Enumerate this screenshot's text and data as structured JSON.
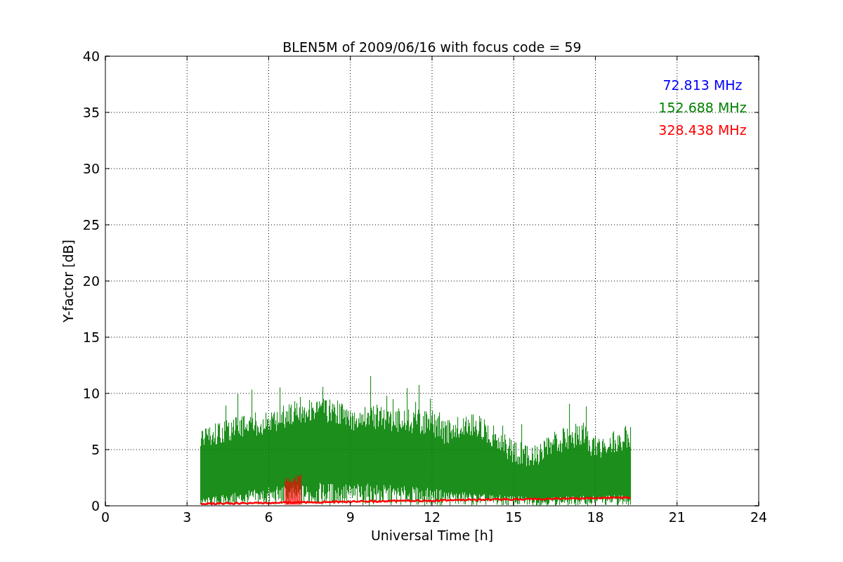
{
  "chart": {
    "title": "BLEN5M of 2009/06/16 with focus code = 59",
    "xlabel": "Universal Time [h]",
    "ylabel": "Y-factor [dB]",
    "xticks": [
      "0",
      "3",
      "6",
      "9",
      "12",
      "15",
      "18",
      "21",
      "24"
    ],
    "yticks": [
      "40",
      "35",
      "30",
      "25",
      "20",
      "15",
      "10",
      "5",
      "0"
    ],
    "legend": [
      {
        "label": "72.813 MHz",
        "color": "#0000ff"
      },
      {
        "label": "152.688 MHz",
        "color": "#008000"
      },
      {
        "label": "328.438 MHz",
        "color": "#ff0000"
      }
    ]
  }
}
